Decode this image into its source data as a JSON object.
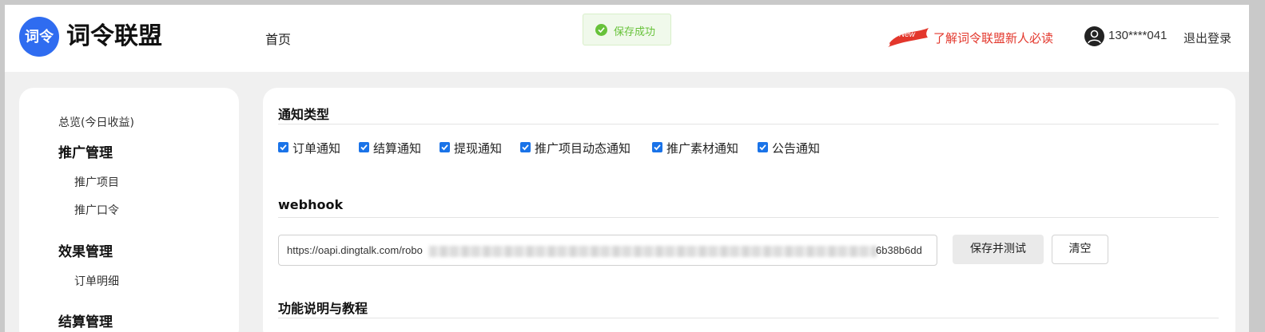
{
  "header": {
    "logo_mark": "词令",
    "logo_text": "词令联盟",
    "nav_home": "首页",
    "toast": "保存成功",
    "new_badge": "New",
    "guide_link": "了解词令联盟新人必读",
    "phone": "130****041",
    "logout": "退出登录"
  },
  "sidebar": {
    "overview": "总览(今日收益)",
    "groups": [
      {
        "title": "推广管理",
        "items": [
          "推广项目",
          "推广口令"
        ]
      },
      {
        "title": "效果管理",
        "items": [
          "订单明细"
        ]
      },
      {
        "title": "结算管理",
        "items": []
      }
    ]
  },
  "main": {
    "notify_section_title": "通知类型",
    "notify_types": [
      {
        "label": "订单通知",
        "checked": true
      },
      {
        "label": "结算通知",
        "checked": true
      },
      {
        "label": "提现通知",
        "checked": true
      },
      {
        "label": "推广项目动态通知",
        "checked": true
      },
      {
        "label": "推广素材通知",
        "checked": true
      },
      {
        "label": "公告通知",
        "checked": true
      }
    ],
    "webhook_section_title": "webhook",
    "webhook_value_start": "https://oapi.dingtalk.com/robo",
    "webhook_value_end": "6b38b6dd",
    "save_test_button": "保存并测试",
    "clear_button": "清空",
    "tutorial_section_title": "功能说明与教程"
  },
  "colors": {
    "brand_blue": "#2f6cf0",
    "success_green": "#67c23a",
    "guide_red": "#e3372c",
    "checkbox_blue": "#1a73e8"
  }
}
